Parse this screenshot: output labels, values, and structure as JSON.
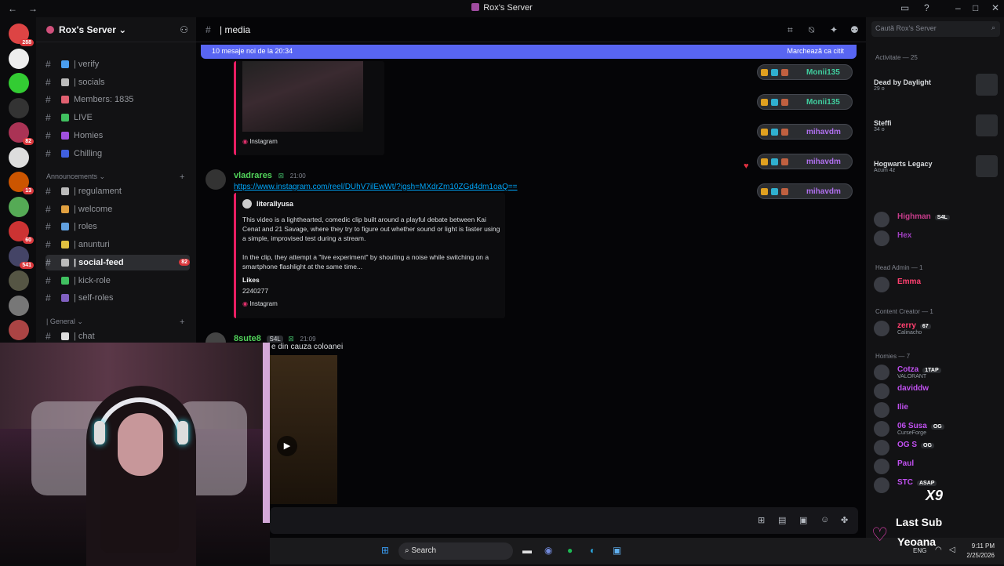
{
  "titlebar": {
    "title": "Rox's Server",
    "back": "←",
    "forward": "→"
  },
  "servers": [
    {
      "color": "#d44",
      "badge": "288"
    },
    {
      "color": "#eee",
      "badge": ""
    },
    {
      "color": "#3c3",
      "badge": ""
    },
    {
      "color": "#333",
      "badge": ""
    },
    {
      "color": "#a35",
      "badge": "82"
    },
    {
      "color": "#ddd",
      "badge": ""
    },
    {
      "color": "#c50",
      "badge": "13"
    },
    {
      "color": "#5a5",
      "badge": ""
    },
    {
      "color": "#c33",
      "badge": "60"
    },
    {
      "color": "#446",
      "badge": "541"
    },
    {
      "color": "#554",
      "badge": ""
    },
    {
      "color": "#777",
      "badge": ""
    },
    {
      "color": "#a44",
      "badge": ""
    }
  ],
  "server": {
    "name": "Rox's Server ⌄"
  },
  "channels": [
    {
      "label": "| verify",
      "color": "#4a9ef0"
    },
    {
      "label": "| socials",
      "color": "#bbb"
    },
    {
      "label": "Members: 1835",
      "color": "#e06070"
    },
    {
      "label": "LIVE",
      "color": "#40c060"
    },
    {
      "label": "Homies",
      "color": "#a050e0"
    },
    {
      "label": "Chilling",
      "color": "#4060e0"
    }
  ],
  "categories": {
    "announcements": "Announcements ⌄",
    "general": "| General ⌄"
  },
  "announce_channels": [
    {
      "label": "| regulament",
      "color": "#bbb",
      "badge": ""
    },
    {
      "label": "| welcome",
      "color": "#e0a040",
      "badge": ""
    },
    {
      "label": "| roles",
      "color": "#60a0e0",
      "badge": ""
    },
    {
      "label": "| anunturi",
      "color": "#e0c040",
      "badge": ""
    },
    {
      "label": "| social-feed",
      "color": "#bbb",
      "badge": "82"
    },
    {
      "label": "| kick-role",
      "color": "#40c060",
      "badge": ""
    },
    {
      "label": "| self-roles",
      "color": "#8060c0",
      "badge": ""
    }
  ],
  "general_channels": [
    {
      "label": "| chat",
      "color": "#ddd"
    }
  ],
  "channel": {
    "name": "| media"
  },
  "newbar": {
    "text": "10 mesaje noi de la 20:34",
    "mark": "Marchează ca citit"
  },
  "embed1": {
    "footer": "Instagram"
  },
  "msg1": {
    "author": "vladrares",
    "time": "21:00",
    "link": "https://www.instagram.com/reel/DUhV7ilEwWt/?igsh=MXdrZm10ZGd4dm1oaQ==",
    "embed_author": "literallyusa",
    "desc1": "This video is a lighthearted, comedic clip built around a playful debate between Kai Cenat and 21 Savage, where they try to figure out whether sound or light is faster using a simple, improvised test during a stream.",
    "desc2": "In the clip, they attempt a \"live experiment\" by shouting a noise while switching on a smartphone flashlight at the same time...",
    "field_name": "Likes",
    "field_value": "2240277",
    "footer": "Instagram"
  },
  "msg2": {
    "author": "8sute8",
    "tag": "S4L",
    "time": "21:09",
    "text": "e din cauza coloanei"
  },
  "reactions": [
    "Monii135",
    "Monii135",
    "mihavdm",
    "mihavdm",
    "mihavdm"
  ],
  "search": {
    "placeholder": "Caută Rox's Server"
  },
  "activity": {
    "header": "Activitate — 25",
    "items": [
      {
        "title": "Dead by Daylight",
        "sub": "29 o"
      },
      {
        "title": "Steffi",
        "sub": "34 o"
      },
      {
        "title": "Hogwarts Legacy",
        "sub": "Acum 4z"
      }
    ]
  },
  "member_groups": [
    {
      "label": "Head Admin — 1"
    },
    {
      "label": "Content Creator — 1"
    },
    {
      "label": "Homies — 7"
    }
  ],
  "members_top": [
    {
      "name": "Highman",
      "tag": "S4L",
      "color": "#c83c8c"
    },
    {
      "name": "Hex",
      "tag": "",
      "color": "#a040c0"
    }
  ],
  "head_admin": [
    {
      "name": "Emma",
      "color": "#ff4070"
    }
  ],
  "content_creator": [
    {
      "name": "zerry",
      "tag": "67",
      "sub": "Calinacho",
      "color": "#ff4070"
    }
  ],
  "homies": [
    {
      "name": "Cotza",
      "tag": "1TAP",
      "sub": "VALORANT",
      "color": "#c050f0"
    },
    {
      "name": "daviddw",
      "tag": "",
      "sub": "",
      "color": "#c050f0"
    },
    {
      "name": "Ilie",
      "tag": "",
      "sub": "",
      "color": "#c050f0"
    },
    {
      "name": "06 Susa",
      "tag": "OG",
      "sub": "CurseForge",
      "color": "#c050f0"
    },
    {
      "name": "OG S",
      "tag": "OG",
      "sub": "",
      "color": "#c050f0"
    },
    {
      "name": "Paul",
      "tag": "",
      "sub": "",
      "color": "#c050f0"
    },
    {
      "name": "STC",
      "tag": "ASAP",
      "sub": "",
      "color": "#c050f0"
    }
  ],
  "overlay": {
    "last_sub": "Last Sub",
    "sub_name": "Yeoana",
    "multiplier": "X9"
  },
  "taskbar": {
    "search": "Search",
    "lang": "ENG",
    "time": "9:11 PM",
    "date": "2/25/2026"
  }
}
